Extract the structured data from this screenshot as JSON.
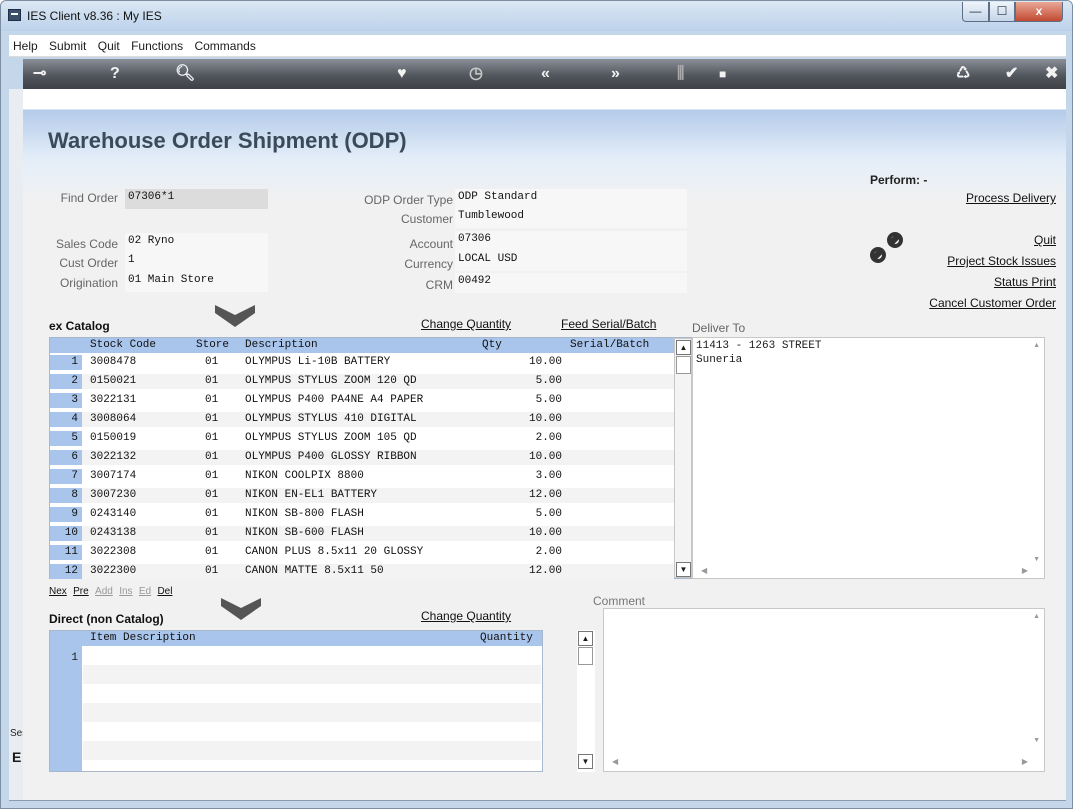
{
  "window": {
    "title": "IES Client v8.36 : My IES",
    "min": "—",
    "max": "☐",
    "close": "x"
  },
  "menu": [
    "Help",
    "Submit",
    "Quit",
    "Functions",
    "Commands"
  ],
  "toolbar": {
    "key": "⊸",
    "help": "?",
    "search": "🔍︎",
    "heart": "♥",
    "clock": "◷",
    "rewind": "«",
    "forward": "»",
    "split": "⫼",
    "stop": "■",
    "recycle": "♺",
    "check": "✔",
    "close": "✖"
  },
  "page": {
    "title": "Warehouse Order Shipment (ODP)"
  },
  "form": {
    "find_order": {
      "label": "Find Order",
      "value": "07306*1"
    },
    "sales_code": {
      "label": "Sales Code",
      "value": "02 Ryno"
    },
    "cust_order": {
      "label": "Cust Order",
      "value": "1"
    },
    "origination": {
      "label": "Origination",
      "value": "01 Main Store"
    },
    "odp_order_type": {
      "label": "ODP Order Type",
      "value": "ODP Standard"
    },
    "customer": {
      "label": "Customer",
      "value": "Tumblewood"
    },
    "account": {
      "label": "Account",
      "value": "07306"
    },
    "currency": {
      "label": "Currency",
      "value": "LOCAL USD"
    },
    "crm": {
      "label": "CRM",
      "value": "00492"
    }
  },
  "perform": {
    "label": "Perform: -",
    "links": [
      "Process Delivery",
      "Quit",
      "Project Stock Issues",
      "Status Print",
      "Cancel Customer Order"
    ]
  },
  "catalog": {
    "title": "ex Catalog",
    "change_quantity": "Change Quantity",
    "feed_serial": "Feed Serial/Batch",
    "headers": {
      "stock_code": "Stock Code",
      "store": "Store",
      "description": "Description",
      "qty": "Qty",
      "serial": "Serial/Batch"
    },
    "rows": [
      {
        "n": "1",
        "code": "3008478",
        "store": "01",
        "desc": "OLYMPUS Li-10B BATTERY",
        "qty": "10.00"
      },
      {
        "n": "2",
        "code": "0150021",
        "store": "01",
        "desc": "OLYMPUS STYLUS ZOOM 120 QD",
        "qty": "5.00"
      },
      {
        "n": "3",
        "code": "3022131",
        "store": "01",
        "desc": "OLYMPUS P400 PA4NE A4 PAPER",
        "qty": "5.00"
      },
      {
        "n": "4",
        "code": "3008064",
        "store": "01",
        "desc": "OLYMPUS STYLUS 410 DIGITAL",
        "qty": "10.00"
      },
      {
        "n": "5",
        "code": "0150019",
        "store": "01",
        "desc": "OLYMPUS STYLUS ZOOM 105 QD",
        "qty": "2.00"
      },
      {
        "n": "6",
        "code": "3022132",
        "store": "01",
        "desc": "OLYMPUS P400 GLOSSY RIBBON",
        "qty": "10.00"
      },
      {
        "n": "7",
        "code": "3007174",
        "store": "01",
        "desc": "NIKON COOLPIX 8800",
        "qty": "3.00"
      },
      {
        "n": "8",
        "code": "3007230",
        "store": "01",
        "desc": "NIKON EN-EL1 BATTERY",
        "qty": "12.00"
      },
      {
        "n": "9",
        "code": "0243140",
        "store": "01",
        "desc": "NIKON SB-800 FLASH",
        "qty": "5.00"
      },
      {
        "n": "10",
        "code": "0243138",
        "store": "01",
        "desc": "NIKON SB-600 FLASH",
        "qty": "10.00"
      },
      {
        "n": "11",
        "code": "3022308",
        "store": "01",
        "desc": "CANON PLUS 8.5x11 20 GLOSSY",
        "qty": "2.00"
      },
      {
        "n": "12",
        "code": "3022300",
        "store": "01",
        "desc": "CANON MATTE 8.5x11 50",
        "qty": "12.00"
      }
    ],
    "row_buttons": [
      "Nex",
      "Pre",
      "Add",
      "Ins",
      "Ed",
      "Del"
    ]
  },
  "deliver_to": {
    "label": "Deliver To",
    "lines": [
      "11413 - 1263 STREET",
      "Suneria"
    ]
  },
  "direct": {
    "title": "Direct (non Catalog)",
    "change_quantity": "Change Quantity",
    "headers": {
      "item": "Item Description",
      "quantity": "Quantity"
    },
    "rows": [
      "1"
    ]
  },
  "comment": {
    "label": "Comment"
  },
  "session": {
    "label": "Ses",
    "glyph": "E"
  }
}
